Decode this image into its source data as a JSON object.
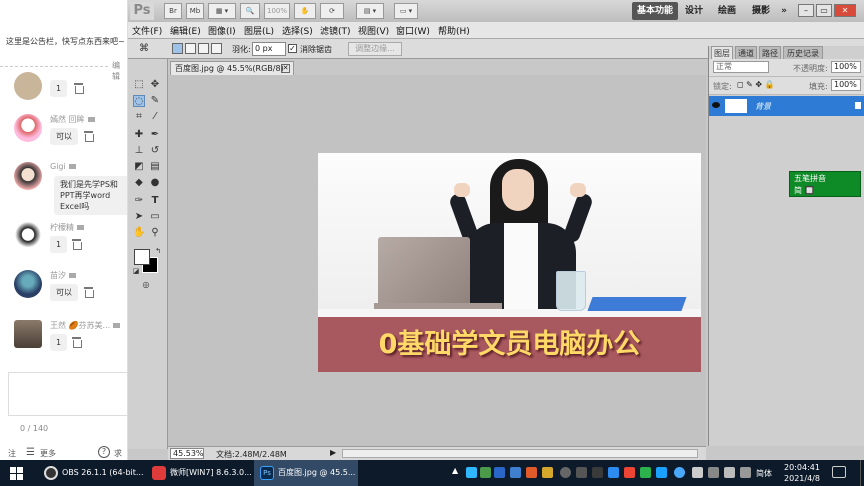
{
  "chat": {
    "notice": "这里是公告栏，快写点东西来吧~",
    "notice_edit": "编辑",
    "messages": [
      {
        "user": "",
        "text": "1"
      },
      {
        "user": "嫣然 回眸",
        "text": "可以"
      },
      {
        "user": "Gigi",
        "text": "我们是先学PS和PPT再学word Excel吗"
      },
      {
        "user": "柠檬精",
        "text": "1"
      },
      {
        "user": "苗汐",
        "text": "可以"
      },
      {
        "user": "王然 🏉芬苏美...",
        "text": "1"
      }
    ],
    "counter": "0 / 140",
    "footer_a": "注",
    "footer_b": "更多",
    "footer_c": "求"
  },
  "ps": {
    "logo": "Ps",
    "zoom_select": "100%",
    "workspaces": [
      "基本功能",
      "设计",
      "绘画",
      "摄影"
    ],
    "workspace_more": "»",
    "menus": [
      "文件(F)",
      "编辑(E)",
      "图像(I)",
      "图层(L)",
      "选择(S)",
      "滤镜(T)",
      "视图(V)",
      "窗口(W)",
      "帮助(H)"
    ],
    "options": {
      "feather_label": "羽化:",
      "feather_value": "0 px",
      "antialias_label": "消除锯齿",
      "refine_button": "调整边缘..."
    },
    "doc_tab": "百度图.jpg @ 45.5%(RGB/8)",
    "banner_text": "0基础学文员电脑办公",
    "status_zoom": "45.53%",
    "status_doc": "文档:2.48M/2.48M",
    "panel": {
      "tabs": [
        "图层",
        "通道",
        "路径",
        "历史记录"
      ],
      "blend_mode": "正常",
      "opacity_label": "不透明度:",
      "opacity_value": "100%",
      "lock_label": "锁定:",
      "fill_label": "填充:",
      "fill_value": "100%",
      "layer_name": "背景"
    },
    "ime": {
      "title": "五笔拼音",
      "row2": "简 🔲"
    }
  },
  "taskbar": {
    "tasks": [
      "OBS 26.1.1 (64-bit...",
      "微师[WIN7] 8.6.3.0...",
      "百度图.jpg @ 45.5..."
    ],
    "lang": "简体",
    "time": "20:04:41",
    "date": "2021/4/8"
  },
  "colors": {
    "banner_bg": "#a8595f",
    "banner_text": "#ffd968",
    "selection_blue": "#2d7bd4",
    "taskbar": "#0c1a2a",
    "ime_green": "#0e8a27"
  }
}
